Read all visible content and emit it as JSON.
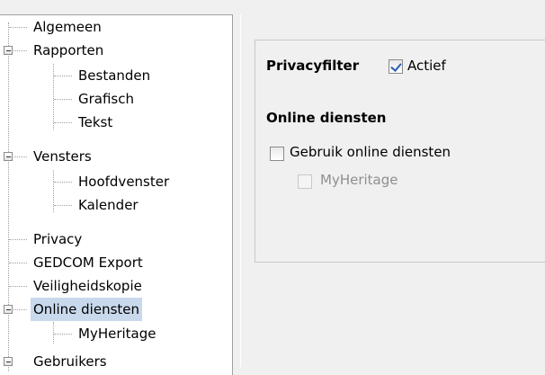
{
  "tree": {
    "items": [
      {
        "label": "Algemeen"
      },
      {
        "label": "Rapporten"
      },
      {
        "label": "Bestanden"
      },
      {
        "label": "Grafisch"
      },
      {
        "label": "Tekst"
      },
      {
        "label": "Vensters"
      },
      {
        "label": "Hoofdvenster"
      },
      {
        "label": "Kalender"
      },
      {
        "label": "Privacy"
      },
      {
        "label": "GEDCOM Export"
      },
      {
        "label": "Veiligheidskopie"
      },
      {
        "label": "Online diensten"
      },
      {
        "label": "MyHeritage"
      },
      {
        "label": "Gebruikers"
      }
    ],
    "selected": "Online diensten"
  },
  "panel": {
    "privacy_label": "Privacyfilter",
    "privacy_checkbox_label": "Actief",
    "privacy_checked": true,
    "section_title": "Online diensten",
    "use_online_label": "Gebruik online diensten",
    "use_online_checked": false,
    "myheritage_label": "MyHeritage",
    "myheritage_checked": false
  },
  "colors": {
    "selection": "#c9d9ec",
    "check": "#2b5fb3"
  }
}
